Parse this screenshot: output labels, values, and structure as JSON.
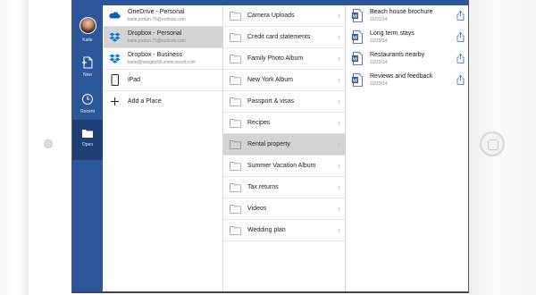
{
  "status_bar": {
    "device": "iPad"
  },
  "rail": {
    "account_label": "Katie",
    "items": [
      {
        "label": "New",
        "icon": "new-document-icon"
      },
      {
        "label": "Recent",
        "icon": "clock-icon"
      },
      {
        "label": "Open",
        "icon": "folder-open-icon",
        "active": true
      }
    ]
  },
  "places": [
    {
      "name": "OneDrive - Personal",
      "sub": "katie.jordan.75@outlook.com",
      "icon": "onedrive-icon"
    },
    {
      "name": "Dropbox - Personal",
      "sub": "katie.jordan.75@outlook.com",
      "icon": "dropbox-icon",
      "selected": true
    },
    {
      "name": "Dropbox - Business",
      "sub": "katiej@wingtip58.onmicrosoft.com",
      "icon": "dropbox-icon"
    },
    {
      "name": "iPad",
      "sub": "",
      "icon": "ipad-icon"
    },
    {
      "name": "Add a Place",
      "sub": "",
      "icon": "plus-icon"
    }
  ],
  "folders": [
    {
      "name": "Camera Uploads"
    },
    {
      "name": "Credit card statements"
    },
    {
      "name": "Family Photo Album"
    },
    {
      "name": "New York Album"
    },
    {
      "name": "Passport & visas"
    },
    {
      "name": "Recipes"
    },
    {
      "name": "Rental property",
      "selected": true
    },
    {
      "name": "Summer Vacation Album"
    },
    {
      "name": "Tax returns"
    },
    {
      "name": "Videos"
    },
    {
      "name": "Wedding plan"
    }
  ],
  "documents": [
    {
      "name": "Beach house brochure",
      "date": "10/31/14"
    },
    {
      "name": "Long term stays",
      "date": "10/23/14"
    },
    {
      "name": "Restaurants nearby",
      "date": "10/29/14"
    },
    {
      "name": "Reviews and feedback",
      "date": "10/23/14"
    }
  ],
  "colors": {
    "rail": "#2b579a",
    "rail_active": "#1e3f73",
    "selection": "#d4d4d4",
    "word_blue": "#2b579a",
    "dropbox_blue": "#007ee5"
  }
}
